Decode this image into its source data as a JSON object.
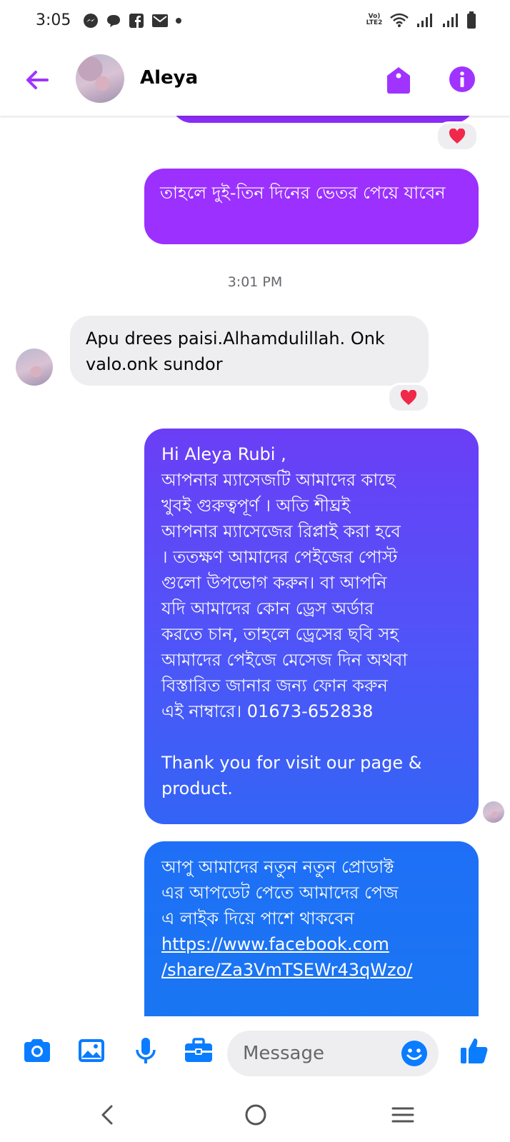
{
  "status_bar": {
    "time": "3:05",
    "icons_left": [
      "messenger-icon",
      "chat-bubble-icon",
      "facebook-icon",
      "mail-icon",
      "dot-icon"
    ],
    "network_label": "Vo) LTE2",
    "icons_right": [
      "wifi-icon",
      "signal-icon",
      "signal-icon",
      "battery-icon"
    ]
  },
  "header": {
    "contact_name": "Aleya",
    "back_icon": "back-arrow-icon",
    "tag_icon": "tag-icon",
    "info_icon": "info-icon"
  },
  "messages": [
    {
      "id": "m1",
      "direction": "outgoing",
      "text": "তাহলে দুই-তিন দিনের ভেতর পেয়ে যাবেন"
    },
    {
      "id": "ts1",
      "type": "timestamp",
      "text": "3:01 PM"
    },
    {
      "id": "m2",
      "direction": "incoming",
      "text": "Apu drees paisi.Alhamdulillah. Onk valo.onk sundor",
      "reaction": "heart"
    },
    {
      "id": "m3",
      "direction": "outgoing",
      "lines": [
        "Hi Aleya Rubi ,",
        "আপনার ম্যাসেজটি আমাদের কাছে",
        "খুবই গুরুত্বপূর্ণ । অতি শীঘ্রই",
        "আপনার ম্যাসেজের রিপ্লাই করা হবে",
        "। ততক্ষণ আমাদের পেইজের পোস্ট",
        "গুলো উপভোগ করুন। বা আপনি",
        "যদি আমাদের কোন ড্রেস অর্ডার",
        "করতে চান, তাহলে ড্রেসের ছবি সহ",
        "আমাদের পেইজে মেসেজ দিন অথবা",
        "বিস্তারিত জানার জন্য ফোন করুন",
        "এই নাম্বারে। 01673-652838",
        "",
        "Thank you for visit our page &",
        "product."
      ]
    },
    {
      "id": "m4",
      "direction": "outgoing",
      "lines": [
        "আপু আমাদের নতুন নতুন প্রোডাক্ট",
        "এর আপডেট পেতে আমাদের পেজ",
        "এ লাইক দিয়ে পাশে থাকবেন"
      ],
      "link_lines": [
        "https://www.facebook.com",
        "/share/Za3VmTSEWr43qWzo/"
      ]
    }
  ],
  "composer": {
    "placeholder": "Message",
    "icons": [
      "camera-icon",
      "gallery-icon",
      "microphone-icon",
      "briefcase-icon",
      "emoji-icon",
      "like-icon"
    ]
  },
  "nav_bar": {
    "icons": [
      "nav-back-icon",
      "nav-home-icon",
      "nav-recents-icon"
    ]
  },
  "colors": {
    "accent_purple": "#a033ff",
    "gradient_top": "#7a3cf5",
    "gradient_mid": "#4b58f8",
    "gradient_bottom": "#1a73f3",
    "icon_blue": "#0a7cff",
    "heart_red": "#f0284a",
    "incoming_bg": "#eeeef1"
  }
}
